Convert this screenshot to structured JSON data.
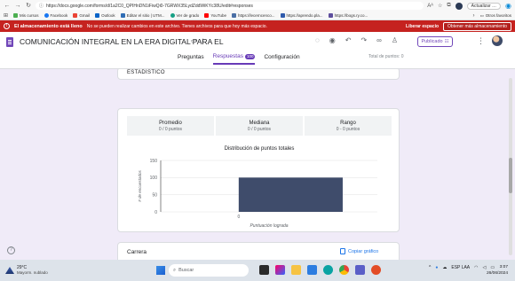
{
  "browser": {
    "url": "https://docs.google.com/forms/d/1a2C0_QPIHnDN1iFiwQi0-7GRWX35LydZddWiKYc38U/edit#responses",
    "update_label": "Actualizar"
  },
  "bookmarks": {
    "items": [
      {
        "label": "Mis cursos",
        "color": "#4caf50"
      },
      {
        "label": "Facebook",
        "color": "#1877f2"
      },
      {
        "label": "Gmail",
        "color": "#ea4335"
      },
      {
        "label": "Outlook",
        "color": "#0a64c8"
      },
      {
        "label": "Editar el sitio | UTM...",
        "color": "#2f6db5"
      },
      {
        "label": "Ver de grado",
        "color": "#16a085"
      },
      {
        "label": "YouTube",
        "color": "#ff0000"
      },
      {
        "label": "https://lecerncenco...",
        "color": "#4a6fa5"
      },
      {
        "label": "https://aprendo.pla...",
        "color": "#2e5aac"
      },
      {
        "label": "https://bogs.ry.co...",
        "color": "#5d4e9d"
      }
    ],
    "other": "Otros favoritos"
  },
  "banner": {
    "title": "El almacenamiento está lleno",
    "message": "No se pueden realizar cambios en este archivo. Tienes archivos para que hoy más espacio.",
    "link": "Liberar espacio",
    "button": "Obtener más almacenamiento"
  },
  "header": {
    "title": "COMUNICACIÓN INTEGRAL EN LA ERA DIGITAL PARA EL",
    "publish_label": "Publicado",
    "tabs": [
      {
        "label": "Preguntas"
      },
      {
        "label": "Respuestas",
        "count": "100"
      },
      {
        "label": "Configuración"
      }
    ],
    "total_points": "Total de puntos: 0"
  },
  "top_card": {
    "label": "ESTADÍSTICO"
  },
  "stats": [
    {
      "label": "Promedio",
      "value": "0 / 0 puntos"
    },
    {
      "label": "Mediana",
      "value": "0 / 0 puntos"
    },
    {
      "label": "Rango",
      "value": "0 - 0 puntos"
    }
  ],
  "chart_data": {
    "type": "bar",
    "title": "Distribución de puntos totales",
    "xlabel": "Puntuación lograda",
    "ylabel": "# de encuestados",
    "categories": [
      "0"
    ],
    "values": [
      100
    ],
    "yticks": [
      0,
      50,
      100,
      150
    ],
    "ylim": [
      0,
      150
    ],
    "color": "#3f4c6b"
  },
  "carrera_card": {
    "label": "Carrera",
    "copy_label": "Copiar gráfico"
  },
  "taskbar": {
    "temperature": "29°C",
    "weather": "Mayorm. nublado",
    "search_placeholder": "Buscar",
    "lang": "ESP LAA",
    "time": "3:07",
    "date": "26/06/2024"
  }
}
